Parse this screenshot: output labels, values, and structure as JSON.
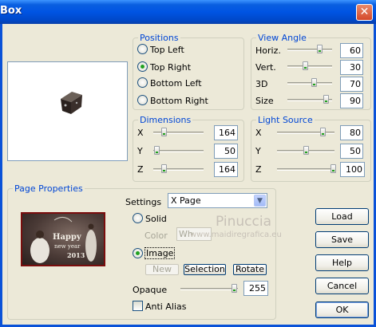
{
  "window": {
    "title": "Box",
    "close_glyph": "✕"
  },
  "positions": {
    "legend": "Positions",
    "options": [
      {
        "label": "Top Left",
        "checked": false
      },
      {
        "label": "Top Right",
        "checked": true
      },
      {
        "label": "Bottom Left",
        "checked": false
      },
      {
        "label": "Bottom Right",
        "checked": false
      }
    ]
  },
  "view_angle": {
    "legend": "View Angle",
    "sliders": [
      {
        "label": "Horiz.",
        "value": "60"
      },
      {
        "label": "Vert.",
        "value": "30"
      },
      {
        "label": "3D",
        "value": "70"
      },
      {
        "label": "Size",
        "value": "90"
      }
    ]
  },
  "dimensions": {
    "legend": "Dimensions",
    "sliders": [
      {
        "label": "X",
        "value": "164"
      },
      {
        "label": "Y",
        "value": "50"
      },
      {
        "label": "Z",
        "value": "164"
      }
    ]
  },
  "light_source": {
    "legend": "Light Source",
    "sliders": [
      {
        "label": "X",
        "value": "80"
      },
      {
        "label": "Y",
        "value": "50"
      },
      {
        "label": "Z",
        "value": "100"
      }
    ]
  },
  "page_properties": {
    "legend": "Page Properties",
    "settings_label": "Settings",
    "settings_value": "X Page",
    "solid_label": "Solid",
    "solid_checked": false,
    "color_label": "Color",
    "color_value": "Wh",
    "image_label": "Image",
    "image_checked": true,
    "new_button": "New",
    "selection_button": "Selection",
    "rotate_button": "Rotate",
    "opaque_label": "Opaque",
    "opaque_value": "255",
    "anti_alias_label": "Anti Alias",
    "anti_alias_checked": false,
    "thumbnail_text_1": "Happy",
    "thumbnail_text_2": "new year",
    "thumbnail_text_3": "2013"
  },
  "buttons": {
    "load": "Load",
    "save": "Save",
    "help": "Help",
    "cancel": "Cancel",
    "ok": "OK"
  },
  "watermark": {
    "line1": "Pinuccia",
    "line2": "www.maidiregrafica.eu"
  },
  "colors": {
    "accent": "#0046d5",
    "title_bar": "#0054e3",
    "slider_green": "#21a121"
  }
}
